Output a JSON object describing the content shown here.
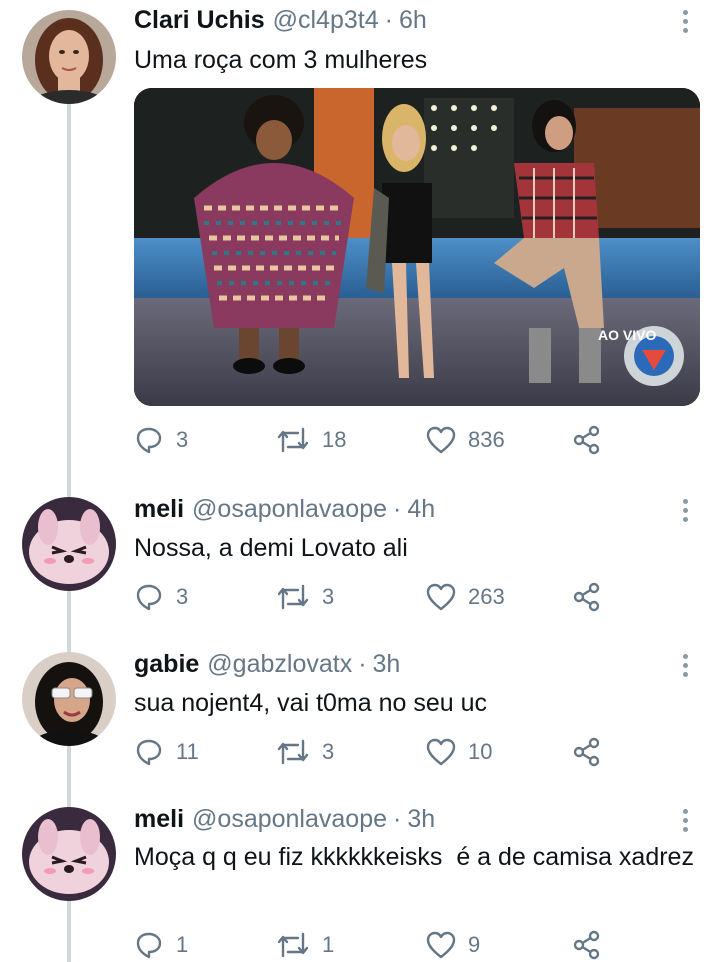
{
  "tweets": [
    {
      "name": "Clari Uchis",
      "handle": "@cl4p3t4",
      "separator": "·",
      "time": "6h",
      "text": "Uma roça com 3 mulheres",
      "media": {
        "overlay_text": "AO VIVO"
      },
      "replies": "3",
      "retweets": "18",
      "likes": "836"
    },
    {
      "name": "meli",
      "handle": "@osaponlavaope",
      "separator": "·",
      "time": "4h",
      "text": "Nossa, a demi Lovato ali",
      "replies": "3",
      "retweets": "3",
      "likes": "263"
    },
    {
      "name": "gabie",
      "handle": "@gabzlovatx",
      "separator": "·",
      "time": "3h",
      "text": "sua nojent4, vai t0ma no seu uc",
      "replies": "11",
      "retweets": "3",
      "likes": "10"
    },
    {
      "name": "meli",
      "handle": "@osaponlavaope",
      "separator": "·",
      "time": "3h",
      "text": "Moça q q eu fiz kkkkkkeisks  é a de camisa xadrez",
      "replies": "1",
      "retweets": "1",
      "likes": "9"
    }
  ],
  "icons": {
    "reply": "reply-icon",
    "retweet": "retweet-icon",
    "like": "heart-icon",
    "share": "share-icon",
    "more": "more-options-icon"
  },
  "colors": {
    "muted": "#657786",
    "thread_line": "#cfd9de",
    "text": "#0f1419"
  }
}
